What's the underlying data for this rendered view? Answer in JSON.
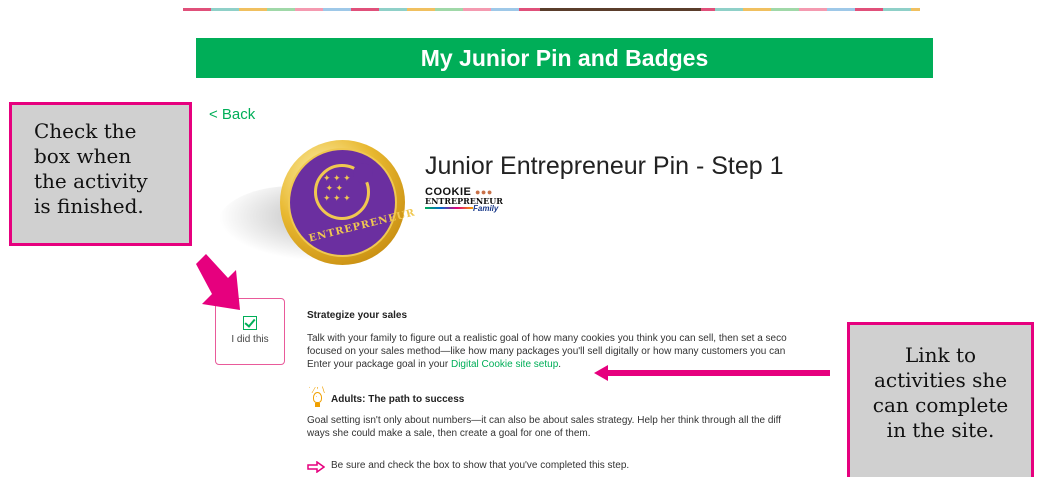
{
  "banner": {
    "title": "My Junior Pin and Badges"
  },
  "nav": {
    "back_label": "< Back"
  },
  "badge": {
    "ring_text": "ENTREPRENEUR"
  },
  "page": {
    "title": "Junior Entrepreneur Pin - Step 1"
  },
  "logo": {
    "line1": "COOKIE",
    "line2": "ENTREPRENEUR",
    "line3": "Family"
  },
  "checkbox": {
    "label": "I did this",
    "checked": true
  },
  "activity": {
    "heading": "Strategize your sales",
    "body_line1": "Talk with your family to figure out a realistic goal of how many cookies you think you can sell, then set a seco",
    "body_line2": "focused on your sales method—like how many packages you'll sell digitally or how many customers you can",
    "body_line3_prefix": "Enter your package goal in your ",
    "link_text": "Digital Cookie site setup",
    "body_line3_suffix": "."
  },
  "adults": {
    "heading": "Adults: The path to success",
    "line1": "Goal setting isn't only about numbers—it can also be about sales strategy. Help her think through all the diff",
    "line2": "ways she could make a sale, then create a goal for one of them."
  },
  "reminder": {
    "text": "Be sure and check the box to show that you've completed this step."
  },
  "callouts": {
    "left_lines": [
      "Check the",
      "box when",
      "the activity",
      "is finished."
    ],
    "right_lines": [
      "Link to",
      "activities she",
      "can complete",
      "in the site."
    ]
  },
  "colors": {
    "brand_green": "#00ae58",
    "callout_pink": "#e6007e",
    "callout_gray": "#d0d0d0",
    "badge_purple": "#6b2fa0",
    "badge_gold": "#f0c850"
  }
}
